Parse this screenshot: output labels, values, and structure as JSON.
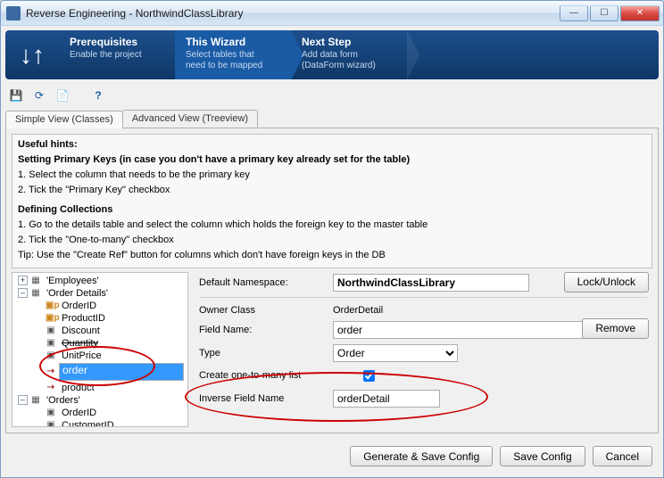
{
  "window": {
    "title": "Reverse Engineering - NorthwindClassLibrary"
  },
  "wizard": {
    "steps": [
      {
        "title": "Prerequisites",
        "desc": "Enable the project"
      },
      {
        "title": "This Wizard",
        "desc": "Select tables that\nneed to be mapped"
      },
      {
        "title": "Next Step",
        "desc": "Add data form\n(DataForm wizard)"
      }
    ]
  },
  "tabs": {
    "simple": "Simple View (Classes)",
    "advanced": "Advanced View (Treeview)"
  },
  "hints": {
    "title": "Useful hints:",
    "pk_title": "Setting Primary Keys (in case you don't have a primary key already set for the table)",
    "pk_1": "1. Select the column that needs to be the primary key",
    "pk_2": "2. Tick the \"Primary Key\" checkbox",
    "coll_title": "Defining Collections",
    "coll_1": "1. Go to the details table and select the column which holds the foreign key to the master table",
    "coll_2": "2. Tick the \"One-to-many\" checkbox",
    "coll_3": "Tip: Use the \"Create Ref\" button for columns which don't have foreign keys in the DB"
  },
  "tree": {
    "n0": "'Employees'",
    "n1": "'Order Details'",
    "n1c": {
      "a": "OrderID",
      "b": "ProductID",
      "c": "Discount",
      "d": "Quantity",
      "e": "UnitPrice",
      "f": "order",
      "g": "product"
    },
    "n2": "'Orders'",
    "n2c": {
      "a": "OrderID",
      "b": "CustomerID"
    }
  },
  "form": {
    "ns_label": "Default Namespace:",
    "ns_value": "NorthwindClassLibrary",
    "lock": "Lock/Unlock",
    "owner_label": "Owner Class",
    "owner_value": "OrderDetail",
    "remove": "Remove",
    "field_label": "Field Name:",
    "field_value": "order",
    "type_label": "Type",
    "type_value": "Order",
    "one2many_label": "Create one-to-many list",
    "inverse_label": "Inverse Field Name",
    "inverse_value": "orderDetail"
  },
  "footer": {
    "generate": "Generate & Save Config",
    "save": "Save Config",
    "cancel": "Cancel"
  }
}
